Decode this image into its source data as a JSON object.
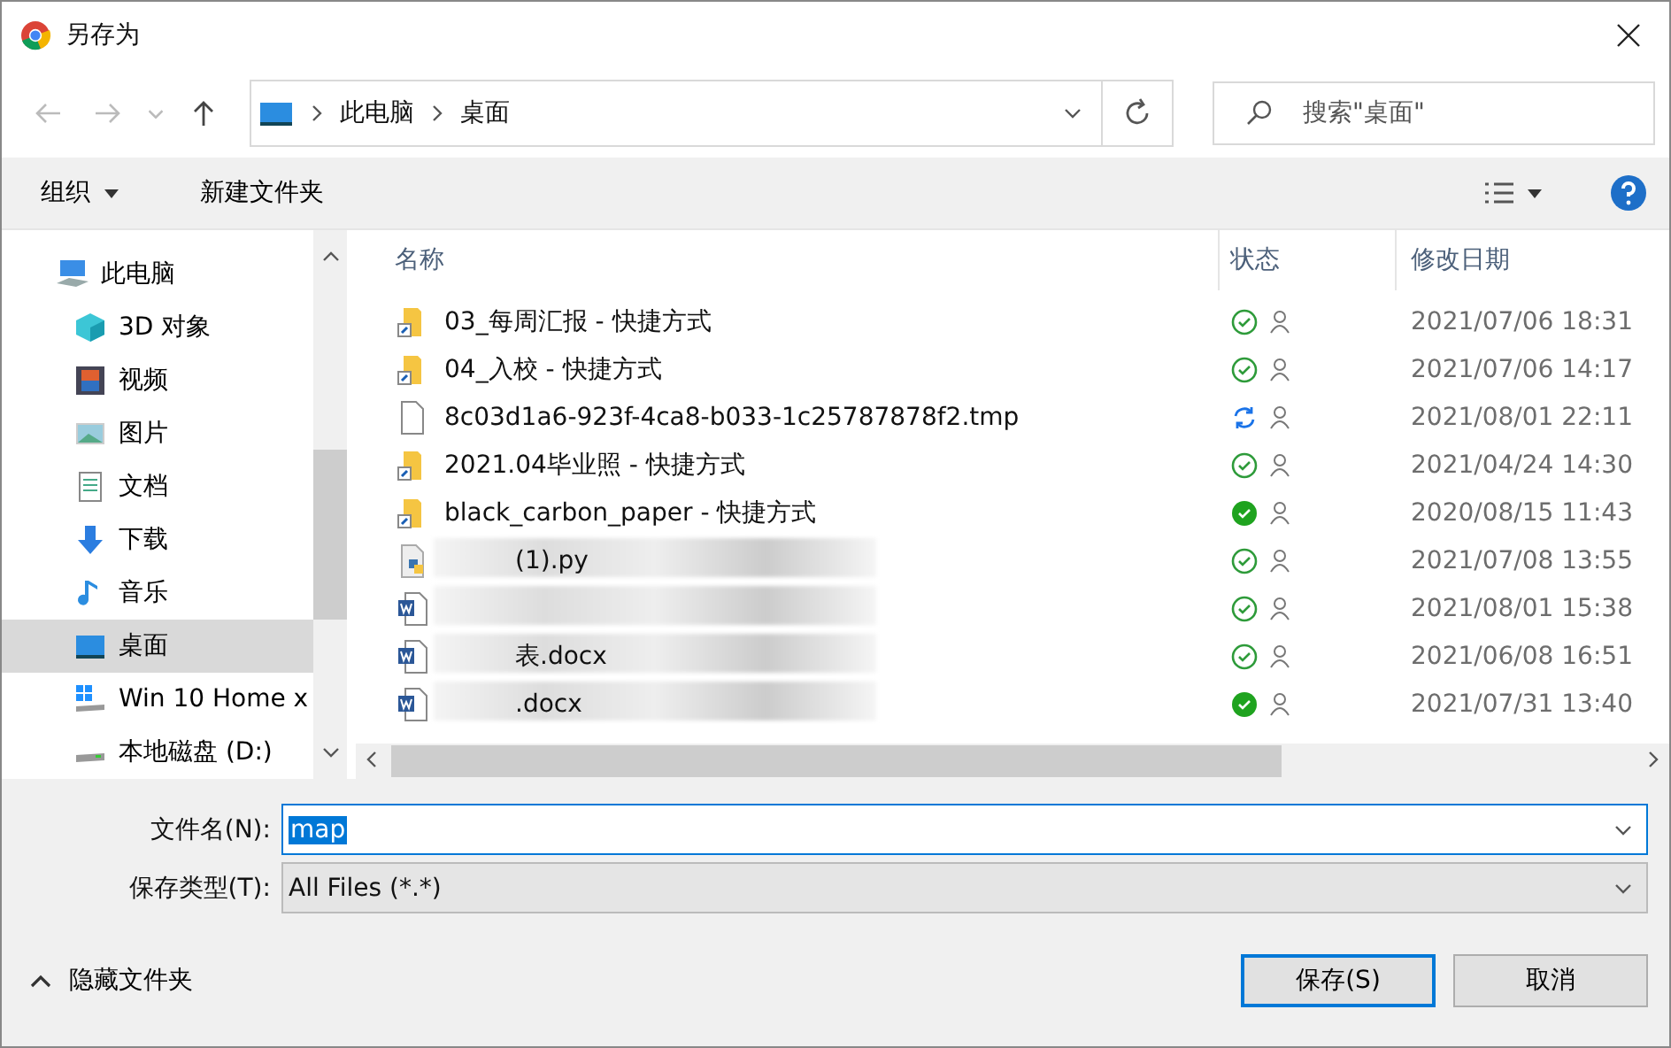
{
  "window": {
    "title": "另存为"
  },
  "address": {
    "crumbs": [
      "此电脑",
      "桌面"
    ]
  },
  "search": {
    "placeholder": "搜索\"桌面\""
  },
  "toolbar": {
    "organize": "组织",
    "new_folder": "新建文件夹"
  },
  "sidebar": {
    "items": [
      {
        "label": "此电脑",
        "selected": false,
        "children": [
          {
            "label": "3D 对象",
            "selected": false
          },
          {
            "label": "视频",
            "selected": false
          },
          {
            "label": "图片",
            "selected": false
          },
          {
            "label": "文档",
            "selected": false
          },
          {
            "label": "下载",
            "selected": false
          },
          {
            "label": "音乐",
            "selected": false
          },
          {
            "label": "桌面",
            "selected": true
          },
          {
            "label": "Win 10 Home x",
            "selected": false
          },
          {
            "label": "本地磁盘 (D:)",
            "selected": false
          }
        ]
      }
    ]
  },
  "table": {
    "columns": [
      "名称",
      "状态",
      "修改日期"
    ],
    "rows": [
      {
        "name": "03_每周汇报 - 快捷方式",
        "kind": "shortcut",
        "syncing": false,
        "pinned": false,
        "date": "2021/07/06 18:31",
        "blurred": false
      },
      {
        "name": "04_入校 - 快捷方式",
        "kind": "shortcut",
        "syncing": false,
        "pinned": false,
        "date": "2021/07/06 14:17",
        "blurred": false
      },
      {
        "name": "8c03d1a6-923f-4ca8-b033-1c25787878f2.tmp",
        "kind": "file",
        "syncing": true,
        "pinned": false,
        "date": "2021/08/01 22:11",
        "blurred": false
      },
      {
        "name": "2021.04毕业照 - 快捷方式",
        "kind": "shortcut",
        "syncing": false,
        "pinned": false,
        "date": "2021/04/24 14:30",
        "blurred": false
      },
      {
        "name": "black_carbon_paper - 快捷方式",
        "kind": "shortcut",
        "syncing": false,
        "pinned": true,
        "date": "2020/08/15 11:43",
        "blurred": false
      },
      {
        "name": "(1).py",
        "kind": "python",
        "syncing": false,
        "pinned": false,
        "date": "2021/07/08 13:55",
        "blurred": true
      },
      {
        "kind": "word",
        "syncing": false,
        "pinned": false,
        "date": "2021/08/01 15:38",
        "blurred": true
      },
      {
        "name": "表.docx",
        "kind": "word",
        "syncing": false,
        "pinned": false,
        "date": "2021/06/08 16:51",
        "blurred": true
      },
      {
        "name": ".docx",
        "kind": "word",
        "syncing": false,
        "pinned": true,
        "date": "2021/07/31 13:40",
        "blurred": true
      }
    ]
  },
  "form": {
    "filename_label": "文件名(N):",
    "filename": "map",
    "type_label": "保存类型(T):",
    "type": "All Files (*.*)"
  },
  "footer": {
    "hide_folders": "隐藏文件夹",
    "save": "保存(S)",
    "cancel": "取消"
  }
}
